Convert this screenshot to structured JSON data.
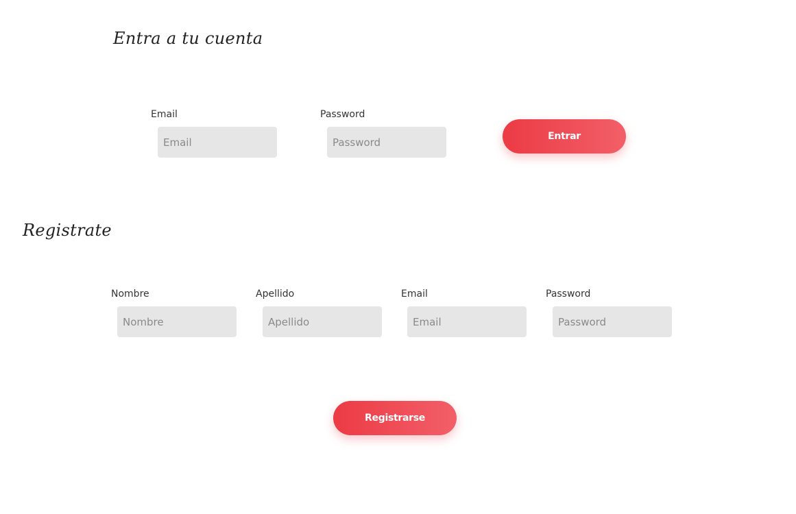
{
  "login": {
    "title": "Entra a tu cuenta",
    "email_label": "Email",
    "email_placeholder": "Email",
    "password_label": "Password",
    "password_placeholder": "Password",
    "submit_label": "Entrar"
  },
  "register": {
    "title": "Registrate",
    "nombre_label": "Nombre",
    "nombre_placeholder": "Nombre",
    "apellido_label": "Apellido",
    "apellido_placeholder": "Apellido",
    "email_label": "Email",
    "email_placeholder": "Email",
    "password_label": "Password",
    "password_placeholder": "Password",
    "submit_label": "Registrarse"
  },
  "colors": {
    "accent": "#ec3b45",
    "accent_light": "#f25f68",
    "input_background": "#e6e6e6"
  }
}
